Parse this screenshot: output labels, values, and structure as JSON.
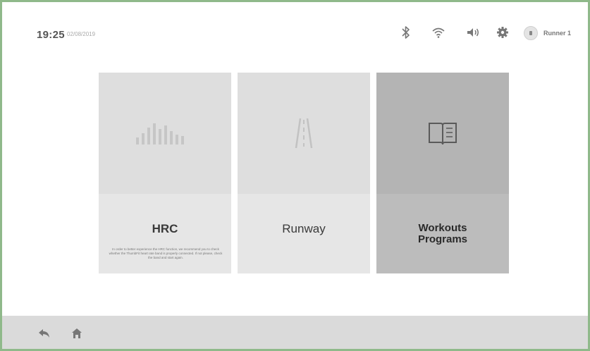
{
  "header": {
    "time": "19:25",
    "date": "02/08/2019",
    "user_name": "Runner 1",
    "icons": [
      "bluetooth-icon",
      "wifi-icon",
      "volume-icon",
      "settings-icon",
      "user-avatar-icon"
    ]
  },
  "cards": [
    {
      "title": "HRC",
      "icon": "equalizer-bars-icon",
      "description": "In order to better experience the HRC function, we recommend you to check whether the ThumbFit heart rate band is properly connected. If not please, check the band and start again."
    },
    {
      "title": "Runway",
      "icon": "road-icon"
    },
    {
      "title": "Workouts Programs",
      "title_line1": "Workouts",
      "title_line2": "Programs",
      "icon": "book-icon",
      "selected": true
    }
  ],
  "footer": {
    "icons": [
      "back-icon",
      "home-icon"
    ]
  },
  "colors": {
    "frame_border": "#8fb98a",
    "card_bg": "#e6e6e6",
    "selected_card_bg": "#b4b4b4",
    "footer_bg": "#dadada"
  }
}
